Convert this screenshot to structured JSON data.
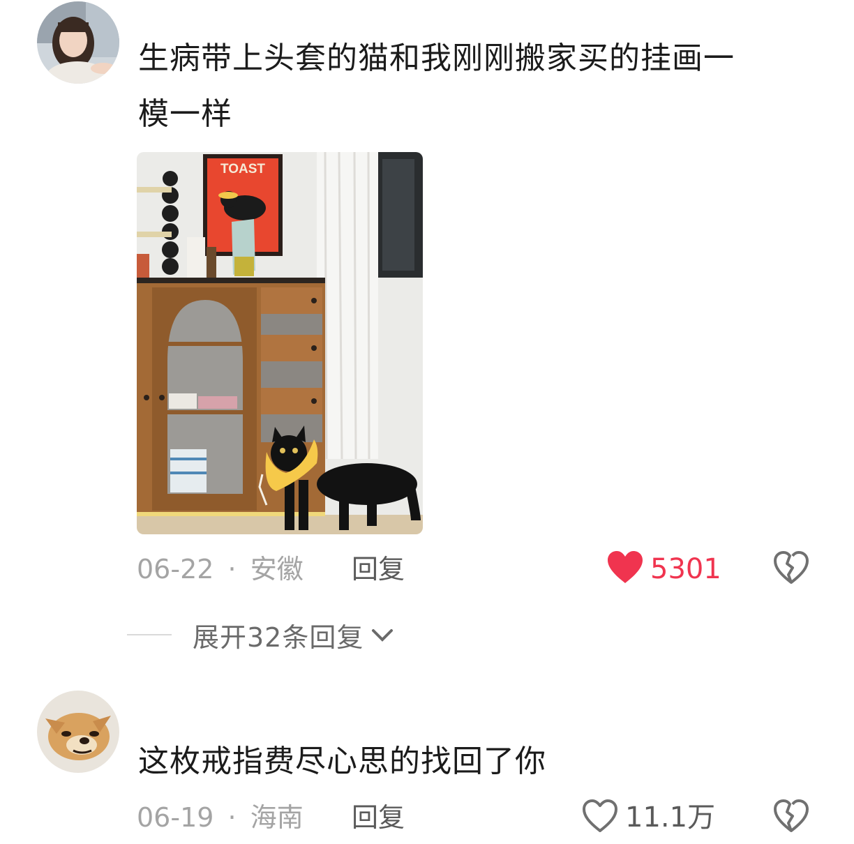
{
  "comments": [
    {
      "text": "生病带上头套的猫和我刚刚搬家买的挂画一模一样",
      "text_line1": "生病带上头套的猫和我刚刚搬家买的挂画一",
      "text_line2": "模一样",
      "date": "06-22",
      "location": "安徽",
      "reply_label": "回复",
      "likes": "5301",
      "liked": true,
      "image_poster_text": "TOAST",
      "expand_label": "展开32条回复"
    },
    {
      "text": "这枚戒指费尽心思的找回了你",
      "date": "06-19",
      "location": "海南",
      "reply_label": "回复",
      "likes": "11.1万",
      "liked": false
    }
  ],
  "separator": "·",
  "colors": {
    "like_active": "#f0344f",
    "meta_gray": "#a4a4a4"
  },
  "icons": {
    "like": "heart-icon",
    "dislike": "broken-heart-icon",
    "expand": "chevron-down-icon"
  }
}
